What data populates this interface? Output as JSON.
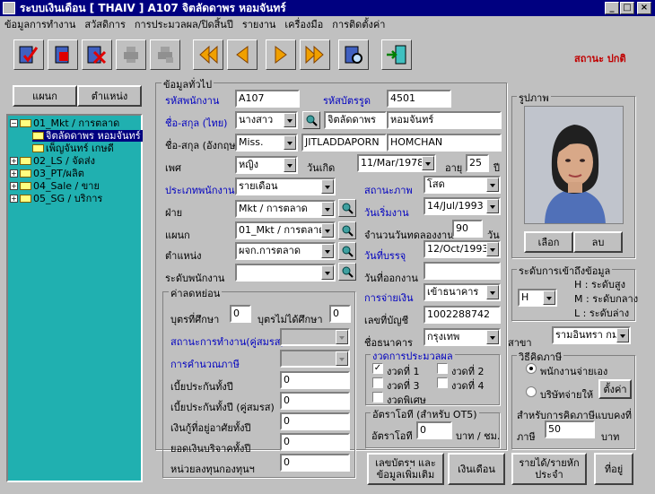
{
  "window": {
    "title": "ระบบเงินเดือน  [ THAIV ]    A107   จิตลัดดาพร  หอมจันทร์",
    "min": "_",
    "max": "□",
    "close": "×"
  },
  "menu": [
    "ข้อมูลการทำงาน",
    "สวัสดิการ",
    "การประมวลผล/ปิดสิ้นปี",
    "รายงาน",
    "เครื่องมือ",
    "การติดตั้งค่า"
  ],
  "status_text": "สถานะ ปกติ",
  "colors": {
    "accent_blue": "#0000c0",
    "status_red": "#c00000",
    "tree_bg": "#20b0b0"
  },
  "left": {
    "btn_dept": "แผนก",
    "btn_position": "ตำแหน่ง",
    "tree": [
      "01_Mkt / การตลาด",
      "จิตลัดดาพร  หอมจันทร์",
      "เพ็ญจันทร์  เกษดี",
      "02_LS / จัดส่ง",
      "03_PT/ผลิต",
      "04_Sale / ขาย",
      "05_SG / บริการ"
    ]
  },
  "general": {
    "legend": "ข้อมูลทั่วไป",
    "emp_code_label": "รหัสพนักงาน",
    "emp_code": "A107",
    "card_label": "รหัสบัตรรูด",
    "card": "4501",
    "name_th_label": "ชื่อ-สกุล (ไทย)",
    "title_th": "นางสาว",
    "first_th": "จิตลัดดาพร",
    "last_th": "หอมจันทร์",
    "name_en_label": "ชื่อ-สกุล (อังกฤษ)",
    "title_en": "Miss.",
    "first_en": "JITLADDAPORN",
    "last_en": "HOMCHAN",
    "sex_label": "เพศ",
    "sex": "หญิง",
    "birth_label": "วันเกิด",
    "birth": "11/Mar/1978",
    "age_label": "อายุ",
    "age": "25",
    "year_unit": "ปี",
    "emptype_label": "ประเภทพนักงาน",
    "emptype": "รายเดือน",
    "marital_label": "สถานะภาพ",
    "marital": "โสด",
    "div_label": "ฝ่าย",
    "div": "Mkt / การตลาด",
    "start_label": "วันเริ่มงาน",
    "start": "14/Jul/1993",
    "dept_label": "แผนก",
    "dept": "01_Mkt / การตลาด",
    "probation_label": "จำนวนวันทดลองงาน",
    "probation": "90",
    "day_unit": "วัน",
    "pos_label": "ตำแหน่ง",
    "pos": "ผจก.การตลาด",
    "confirm_label": "วันที่บรรจุ",
    "confirm": "12/Oct/1993",
    "level_label": "ระดับพนักงาน",
    "level": "",
    "leave_label": "วันที่ออกงาน",
    "leave": ""
  },
  "allow": {
    "legend": "ค่าลดหย่อน",
    "child_study_label": "บุตรที่ศึกษา",
    "child_study": "0",
    "child_nostudy_label": "บุตรไม่ได้ศึกษา",
    "child_nostudy": "0",
    "spouse_work_label": "สถานะการทำงาน(คู่สมรส)",
    "tax_calc_label": "การคำนวณภาษี",
    "ins_label": "เบี้ยประกันทั้งปี",
    "ins": "0",
    "ins_sp_label": "เบี้ยประกันทั้งปี (คู่สมรส)",
    "ins_sp": "0",
    "loan_label": "เงินกู้ที่อยู่อาศัยทั้งปี",
    "loan": "0",
    "donate_label": "ยอดเงินบริจาคทั้งปี",
    "donate": "0",
    "fund_label": "หน่วยลงทุนกองทุนฯ",
    "fund": "0"
  },
  "pay": {
    "method_label": "การจ่ายเงิน",
    "method": "เข้าธนาคาร",
    "acct_label": "เลขที่บัญชี",
    "acct": "1002288742",
    "bank_label": "ชื่อธนาคาร",
    "bank": "กรุงเทพ",
    "branch_label": "สาขา",
    "branch": "รามอินทรา กม"
  },
  "process": {
    "legend": "งวดการประมวลผล",
    "p1": "งวดที่ 1",
    "p2": "งวดที่ 2",
    "p3": "งวดที่ 3",
    "p4": "งวดที่ 4",
    "special": "งวดพิเศษ",
    "p1_checked": true,
    "p2_checked": false,
    "p3_checked": false,
    "p4_checked": false,
    "special_checked": false
  },
  "ot": {
    "legend": "อัตราโอที (สำหรับ OT5)",
    "rate_label": "อัตราโอที",
    "rate": "0",
    "unit": "บาท / ชม."
  },
  "photo": {
    "legend": "รูปภาพ",
    "select": "เลือก",
    "delete": "ลบ"
  },
  "access": {
    "legend": "ระดับการเข้าถึงข้อมูล",
    "level": "H",
    "h": "H : ระดับสูง",
    "m": "M : ระดับกลาง",
    "l": "L : ระดับล่าง"
  },
  "tax": {
    "legend": "วิธีคิดภาษี",
    "emp_pays": "พนักงานจ่ายเอง",
    "co_pays": "บริษัทจ่ายให้",
    "setup": "ตั้งค่า",
    "flat_label": "สำหรับการคิดภาษีแบบคงที่",
    "rate_label": "ภาษี",
    "rate": "50",
    "unit": "บาท"
  },
  "bottom": {
    "idcard": "เลขบัตรฯ และ ข้อมูลเพิ่มเติม",
    "salary": "เงินเดือน",
    "income": "รายได้/รายหัก ประจำ",
    "address": "ที่อยู่"
  }
}
